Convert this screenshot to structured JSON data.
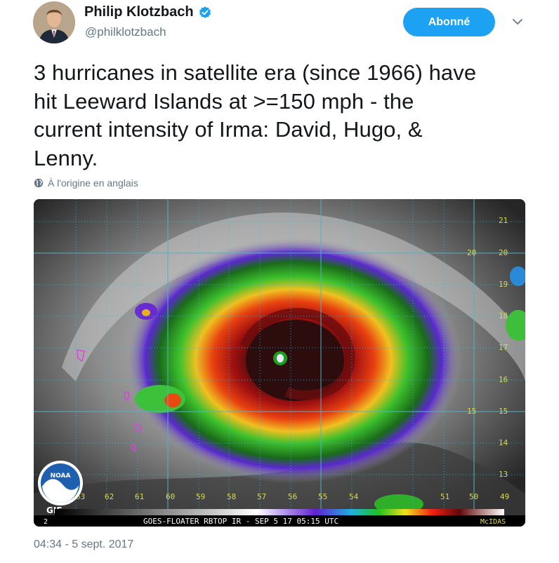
{
  "author": {
    "name": "Philip Klotzbach",
    "handle": "@philklotzbach",
    "verified": true
  },
  "follow_button": {
    "label": "Abonné"
  },
  "tweet": {
    "lines": [
      "3 hurricanes in satellite era (since 1966) have",
      "hit Leeward Islands at >=150 mph - the",
      "current intensity of Irma: David, Hugo, &",
      "Lenny."
    ]
  },
  "translate_note": "À l'origine en anglais",
  "media": {
    "caption_bar": "GOES-FLOATER RBTOP IR - SEP 5 17 05:15 UTC",
    "mcidas_label": "McIDAS",
    "gif_badge": "GIF",
    "frame_number": "2",
    "noaa_text": "NOAA",
    "lon_labels": [
      "63",
      "62",
      "61",
      "60",
      "59",
      "58",
      "57",
      "56",
      "55",
      "54",
      "51",
      "50",
      "49"
    ],
    "lat_labels": [
      "21",
      "20",
      "19",
      "18",
      "17",
      "16",
      "15",
      "14",
      "13"
    ],
    "grid_labels": {
      "lat20": "20",
      "lat15": "15"
    }
  },
  "timestamp": "04:34 - 5 sept. 2017",
  "colors": {
    "accent": "#1da1f2",
    "text": "#14171a",
    "muted": "#657786",
    "verified": "#1da1f2"
  }
}
